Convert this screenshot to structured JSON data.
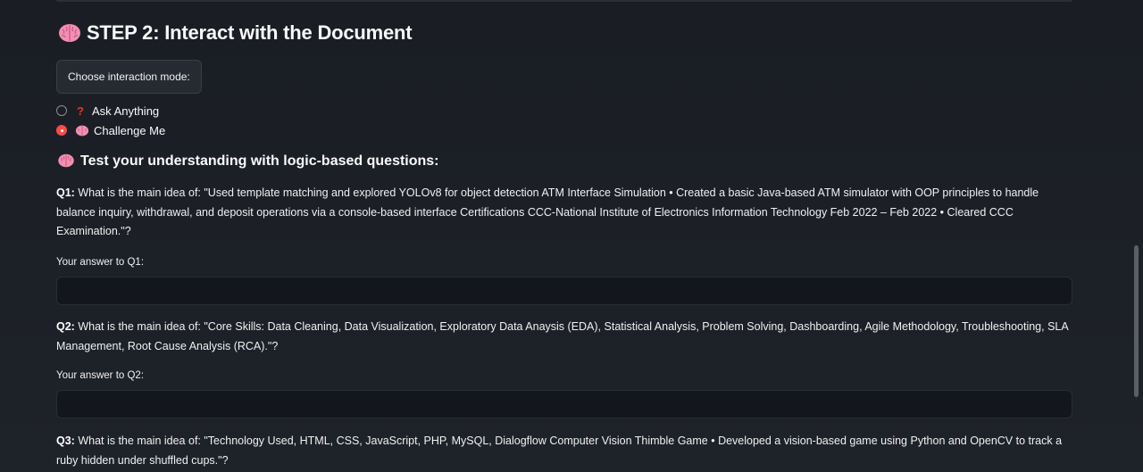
{
  "step": {
    "title": "STEP 2: Interact with the Document",
    "icon": "brain-icon"
  },
  "mode": {
    "label": "Choose interaction mode:",
    "options": [
      {
        "icon": "question-mark-icon",
        "glyph": "?",
        "label": "Ask Anything",
        "checked": false
      },
      {
        "icon": "brain-icon",
        "label": "Challenge Me",
        "checked": true
      }
    ]
  },
  "challenge": {
    "heading": "Test your understanding with logic-based questions:",
    "questions": [
      {
        "prefix": "Q1:",
        "text": " What is the main idea of: \"Used template matching and explored YOLOv8 for object detection ATM Interface Simulation • Created a basic Java-based ATM simulator with OOP principles to handle balance inquiry, withdrawal, and deposit operations via a console-based interface Certifications CCC-National Institute of Electronics Information Technology Feb 2022 – Feb 2022 • Cleared CCC Examination.\"?",
        "answer_label": "Your answer to Q1:",
        "answer_value": ""
      },
      {
        "prefix": "Q2:",
        "text": " What is the main idea of: \"Core Skills: Data Cleaning, Data Visualization, Exploratory Data Anaysis (EDA), Statistical Analysis, Problem Solving, Dashboarding, Agile Methodology, Troubleshooting, SLA Management, Root Cause Analysis (RCA).\"?",
        "answer_label": "Your answer to Q2:",
        "answer_value": ""
      },
      {
        "prefix": "Q3:",
        "text": " What is the main idea of: \"Technology Used, HTML, CSS, JavaScript, PHP, MySQL, Dialogflow Computer Vision Thimble Game • Developed a vision-based game using Python and OpenCV to track a ruby hidden under shuffled cups.\"?"
      }
    ]
  },
  "colors": {
    "background": "#1c1f26",
    "accent": "#ff4b4b",
    "input_bg": "#13161c",
    "text": "#fafafa"
  }
}
